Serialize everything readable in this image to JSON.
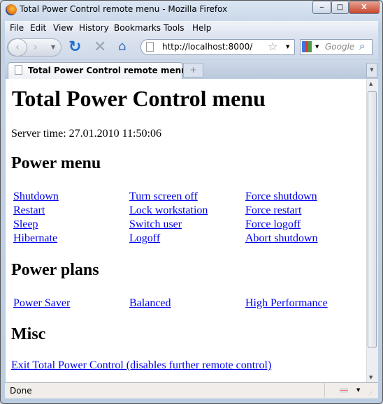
{
  "window": {
    "title": "Total Power Control remote menu - Mozilla Firefox",
    "min": "‒",
    "max": "□",
    "close": "X"
  },
  "menu": [
    "File",
    "Edit",
    "View",
    "History",
    "Bookmarks",
    "Tools",
    "Help"
  ],
  "nav": {
    "url": "http://localhost:8000/",
    "search_placeholder": "Google",
    "icons": [
      "back-icon",
      "forward-icon",
      "reload-icon",
      "stop-icon",
      "home-icon",
      "bookmark-star-icon",
      "search-icon"
    ]
  },
  "tab": {
    "title": "Total Power Control remote menu",
    "new_tab": "+"
  },
  "page": {
    "title": "Total Power Control menu",
    "server_time": "Server time: 27.01.2010 11:50:06",
    "power_menu": {
      "heading": "Power menu",
      "rows": [
        [
          "Shutdown",
          "Turn screen off",
          "Force shutdown"
        ],
        [
          "Restart",
          "Lock workstation",
          "Force restart"
        ],
        [
          "Sleep",
          "Switch user",
          "Force logoff"
        ],
        [
          "Hibernate",
          "Logoff",
          "Abort shutdown"
        ]
      ]
    },
    "power_plans": {
      "heading": "Power plans",
      "items": [
        "Power Saver",
        "Balanced",
        "High Performance"
      ]
    },
    "misc": {
      "heading": "Misc",
      "exit_link": "Exit Total Power Control (disables further remote control)"
    }
  },
  "status": {
    "text": "Done"
  }
}
